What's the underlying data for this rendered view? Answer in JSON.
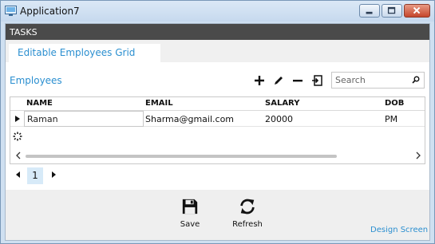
{
  "window": {
    "title": "Application7"
  },
  "tasks_bar": {
    "label": "TASKS"
  },
  "tabs": [
    {
      "label": "Editable Employees Grid",
      "active": true
    }
  ],
  "section": {
    "title": "Employees"
  },
  "toolbar": {
    "icons": [
      "add-icon",
      "edit-icon",
      "delete-icon",
      "export-icon"
    ],
    "search_placeholder": "Search"
  },
  "grid": {
    "columns": [
      "NAME",
      "EMAIL",
      "SALARY",
      "DOB"
    ],
    "rows": [
      {
        "name": "Raman",
        "email": "Sharma@gmail.com",
        "salary": "20000",
        "dob": "PM"
      }
    ]
  },
  "pager": {
    "current_page": "1"
  },
  "footer": {
    "save_label": "Save",
    "refresh_label": "Refresh",
    "design_link": "Design Screen"
  },
  "colors": {
    "accent": "#2b8fd0",
    "tasks_bar": "#4a4a4a",
    "window_frame": "#cfe0f1"
  }
}
